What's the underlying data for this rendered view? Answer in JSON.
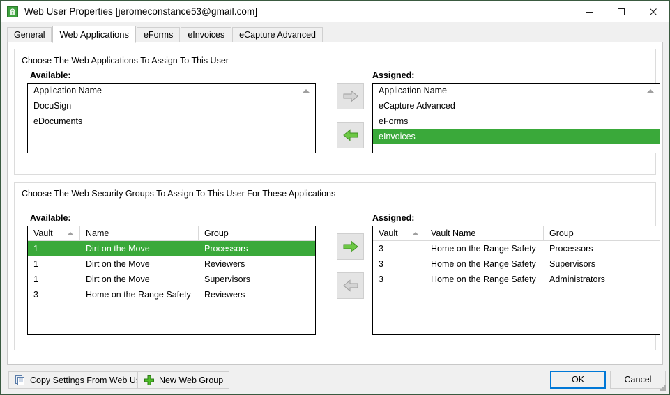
{
  "window": {
    "title": "Web User Properties [jeromeconstance53@gmail.com]",
    "icon": "web-user-icon",
    "controls": {
      "minimize": "minimize-icon",
      "maximize": "maximize-icon",
      "close": "close-icon"
    }
  },
  "tabs": [
    {
      "label": "General",
      "active": false
    },
    {
      "label": "Web Applications",
      "active": true
    },
    {
      "label": "eForms",
      "active": false
    },
    {
      "label": "eInvoices",
      "active": false
    },
    {
      "label": "eCapture Advanced",
      "active": false
    }
  ],
  "apps_panel": {
    "caption": "Choose The Web Applications To Assign To This User",
    "available_label": "Available:",
    "assigned_label": "Assigned:",
    "available": {
      "column_header": "Application Name",
      "sort": "ascending",
      "rows": [
        {
          "name": "DocuSign",
          "selected": false
        },
        {
          "name": "eDocuments",
          "selected": false
        }
      ]
    },
    "assigned": {
      "column_header": "Application Name",
      "sort": "ascending",
      "rows": [
        {
          "name": "eCapture Advanced",
          "selected": false
        },
        {
          "name": "eForms",
          "selected": false
        },
        {
          "name": "eInvoices",
          "selected": true
        }
      ]
    },
    "assign_button": {
      "icon": "arrow-right-icon",
      "enabled": false
    },
    "unassign_button": {
      "icon": "arrow-left-icon",
      "enabled": true
    }
  },
  "groups_panel": {
    "caption": "Choose The Web Security Groups To Assign To This User For These Applications",
    "available_label": "Available:",
    "assigned_label": "Assigned:",
    "available": {
      "columns": [
        "Vault",
        "Name",
        "Group"
      ],
      "sort_column": "Vault",
      "sort": "ascending",
      "rows": [
        {
          "vault": "1",
          "name": "Dirt on the Move",
          "group": "Processors",
          "selected": true
        },
        {
          "vault": "1",
          "name": "Dirt on the Move",
          "group": "Reviewers",
          "selected": false
        },
        {
          "vault": "1",
          "name": "Dirt on the Move",
          "group": "Supervisors",
          "selected": false
        },
        {
          "vault": "3",
          "name": "Home on the Range Safety",
          "group": "Reviewers",
          "selected": false
        }
      ]
    },
    "assigned": {
      "columns": [
        "Vault",
        "Vault Name",
        "Group"
      ],
      "sort_column": "Vault",
      "sort": "ascending",
      "rows": [
        {
          "vault": "3",
          "name": "Home on the Range Safety",
          "group": "Processors",
          "selected": false
        },
        {
          "vault": "3",
          "name": "Home on the Range Safety",
          "group": "Supervisors",
          "selected": false
        },
        {
          "vault": "3",
          "name": "Home on the Range Safety",
          "group": "Administrators",
          "selected": false
        }
      ]
    },
    "assign_button": {
      "icon": "arrow-right-icon",
      "enabled": true
    },
    "unassign_button": {
      "icon": "arrow-left-icon",
      "enabled": false
    }
  },
  "footer": {
    "copy_settings_label": "Copy Settings From Web User",
    "copy_settings_icon": "copy-document-icon",
    "new_web_group_label": "New Web Group",
    "new_web_group_icon": "plus-icon",
    "ok_label": "OK",
    "cancel_label": "Cancel",
    "resize_grip": "resize-grip-icon"
  },
  "colors": {
    "selection_green": "#3aa93a",
    "accent_blue": "#0078d7",
    "arrow_green": "#6dc845",
    "window_border": "#3a5a40"
  }
}
